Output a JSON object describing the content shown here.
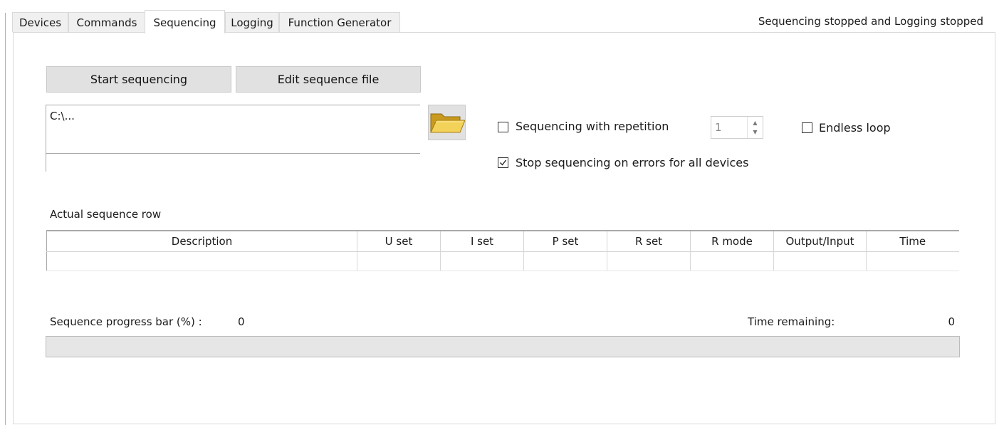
{
  "tabs": [
    {
      "label": "Devices",
      "active": false
    },
    {
      "label": "Commands",
      "active": false
    },
    {
      "label": "Sequencing",
      "active": true
    },
    {
      "label": "Logging",
      "active": false
    },
    {
      "label": "Function Generator",
      "active": false
    }
  ],
  "status_text": "Sequencing stopped and Logging stopped",
  "buttons": {
    "start_sequencing": "Start sequencing",
    "edit_sequence_file": "Edit sequence file"
  },
  "file": {
    "path": "C:\\...",
    "status_line": "",
    "browse_icon": "folder-open-icon"
  },
  "options": {
    "repetition_label": "Sequencing with repetition",
    "repetition_checked": false,
    "repetition_count": "1",
    "endless_loop_label": "Endless loop",
    "endless_loop_checked": false,
    "stop_on_errors_label": "Stop sequencing on errors for all devices",
    "stop_on_errors_checked": true
  },
  "actual_row": {
    "title": "Actual sequence row",
    "columns": [
      "Description",
      "U set",
      "I set",
      "P set",
      "R set",
      "R mode",
      "Output/Input",
      "Time"
    ],
    "row": [
      "",
      "",
      "",
      "",
      "",
      "",
      "",
      ""
    ]
  },
  "progress": {
    "label": "Sequence progress bar (%) :",
    "value_text": "0",
    "value_percent": 0,
    "time_remaining_label": "Time remaining:",
    "time_remaining_value": "0"
  },
  "colors": {
    "button_bg": "#e1e1e1",
    "progress_bg": "#e6e6e6",
    "progress_fill": "#06b025",
    "accent_rule": "#9cb3d4"
  }
}
